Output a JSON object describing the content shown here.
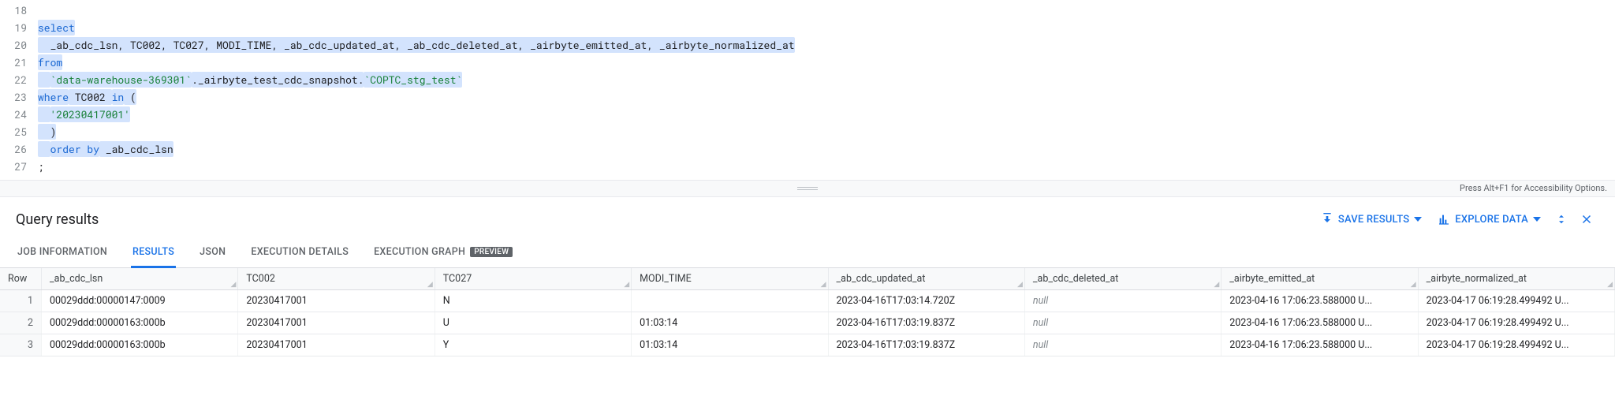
{
  "editor": {
    "lines": [
      {
        "num": 18,
        "tokens": []
      },
      {
        "num": 19,
        "tokens": [
          {
            "t": "select",
            "cls": "tok-kw",
            "sel": true
          }
        ]
      },
      {
        "num": 20,
        "tokens": [
          {
            "t": "  _ab_cdc_lsn, TC002, TC027, MODI_TIME, _ab_cdc_updated_at, _ab_cdc_deleted_at, _airbyte_emitted_at, _airbyte_normalized_at",
            "cls": "tok-plain",
            "sel": true
          }
        ]
      },
      {
        "num": 21,
        "tokens": [
          {
            "t": "from",
            "cls": "tok-kw",
            "sel": true
          }
        ]
      },
      {
        "num": 22,
        "tokens": [
          {
            "t": "  ",
            "cls": "tok-plain",
            "sel": true
          },
          {
            "t": "`data-warehouse-369301`",
            "cls": "tok-str",
            "sel": true
          },
          {
            "t": "._airbyte_test_cdc_snapshot.",
            "cls": "tok-plain",
            "sel": true
          },
          {
            "t": "`COPTC_stg_test`",
            "cls": "tok-str",
            "sel": true
          }
        ]
      },
      {
        "num": 23,
        "tokens": [
          {
            "t": "where",
            "cls": "tok-kw",
            "sel": true
          },
          {
            "t": " TC002 ",
            "cls": "tok-plain",
            "sel": true
          },
          {
            "t": "in",
            "cls": "tok-kw",
            "sel": true
          },
          {
            "t": " (",
            "cls": "tok-plain",
            "sel": true
          }
        ]
      },
      {
        "num": 24,
        "tokens": [
          {
            "t": "  ",
            "cls": "tok-plain",
            "sel": true
          },
          {
            "t": "'20230417001'",
            "cls": "tok-str",
            "sel": true
          }
        ]
      },
      {
        "num": 25,
        "tokens": [
          {
            "t": "  )",
            "cls": "tok-plain",
            "sel": true
          }
        ]
      },
      {
        "num": 26,
        "tokens": [
          {
            "t": "  ",
            "cls": "tok-plain",
            "sel": true
          },
          {
            "t": "order by",
            "cls": "tok-kw",
            "sel": true
          },
          {
            "t": " _ab_cdc_lsn",
            "cls": "tok-plain",
            "sel": true
          }
        ]
      },
      {
        "num": 27,
        "tokens": [
          {
            "t": ";",
            "cls": "tok-plain",
            "sel": false
          }
        ]
      }
    ]
  },
  "accessibility_hint": "Press Alt+F1 for Accessibility Options.",
  "results": {
    "title": "Query results",
    "actions": {
      "save_results": "SAVE RESULTS",
      "explore_data": "EXPLORE DATA"
    },
    "tabs": {
      "job_info": "JOB INFORMATION",
      "results": "RESULTS",
      "json": "JSON",
      "exec_details": "EXECUTION DETAILS",
      "exec_graph": "EXECUTION GRAPH",
      "preview_badge": "PREVIEW"
    },
    "columns": [
      "Row",
      "_ab_cdc_lsn",
      "TC002",
      "TC027",
      "MODI_TIME",
      "_ab_cdc_updated_at",
      "_ab_cdc_deleted_at",
      "_airbyte_emitted_at",
      "_airbyte_normalized_at"
    ],
    "rows": [
      {
        "idx": 1,
        "lsn": "00029ddd:00000147:0009",
        "tc002": "20230417001",
        "tc027": "N",
        "modi": "",
        "upd": "2023-04-16T17:03:14.720Z",
        "del": null,
        "emit": "2023-04-16 17:06:23.588000 U...",
        "norm": "2023-04-17 06:19:28.499492 U..."
      },
      {
        "idx": 2,
        "lsn": "00029ddd:00000163:000b",
        "tc002": "20230417001",
        "tc027": "U",
        "modi": "01:03:14",
        "upd": "2023-04-16T17:03:19.837Z",
        "del": null,
        "emit": "2023-04-16 17:06:23.588000 U...",
        "norm": "2023-04-17 06:19:28.499492 U..."
      },
      {
        "idx": 3,
        "lsn": "00029ddd:00000163:000b",
        "tc002": "20230417001",
        "tc027": "Y",
        "modi": "01:03:14",
        "upd": "2023-04-16T17:03:19.837Z",
        "del": null,
        "emit": "2023-04-16 17:06:23.588000 U...",
        "norm": "2023-04-17 06:19:28.499492 U..."
      }
    ],
    "null_label": "null"
  }
}
